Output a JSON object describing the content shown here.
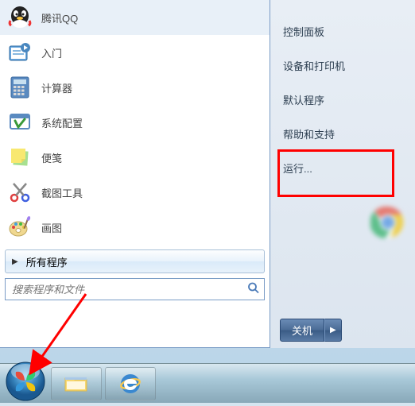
{
  "programs": [
    {
      "label": "腾讯QQ",
      "icon": "qq"
    },
    {
      "label": "入门",
      "icon": "getstarted"
    },
    {
      "label": "计算器",
      "icon": "calculator"
    },
    {
      "label": "系统配置",
      "icon": "msconfig"
    },
    {
      "label": "便笺",
      "icon": "stickynotes"
    },
    {
      "label": "截图工具",
      "icon": "snipping"
    },
    {
      "label": "画图",
      "icon": "paint"
    }
  ],
  "all_programs_label": "所有程序",
  "search_placeholder": "搜索程序和文件",
  "right_menu": {
    "control_panel": "控制面板",
    "devices": "设备和打印机",
    "default_programs": "默认程序",
    "help": "帮助和支持",
    "run": "运行..."
  },
  "shutdown_label": "关机"
}
